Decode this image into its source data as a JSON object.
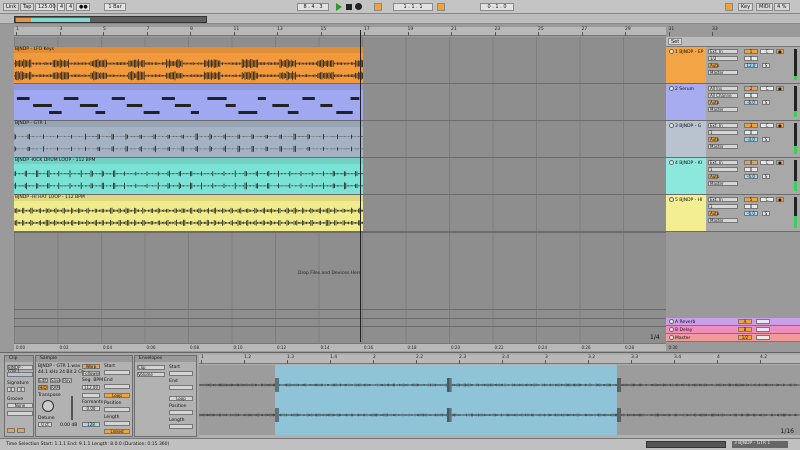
{
  "topbar": {
    "link": "Link",
    "tap": "Tap",
    "tempo": "125.00",
    "sig_num": "4",
    "sig_den": "4",
    "metro": "●●",
    "quant": "1 Bar",
    "position": "8 . 4 . 3",
    "loop_start": "1 . 1 . 1",
    "loop_len": "0 . 1 . 0",
    "key": "Key",
    "midi": "MIDI",
    "cpu": "4 %"
  },
  "ruler": [
    "1",
    "3",
    "5",
    "7",
    "9",
    "11",
    "13",
    "15",
    "17",
    "19",
    "21",
    "23",
    "25",
    "27",
    "29",
    "31",
    "33"
  ],
  "timeline": [
    "0:00",
    "0:02",
    "0:04",
    "0:06",
    "0:08",
    "0:10",
    "0:12",
    "0:14",
    "0:16",
    "0:18",
    "0:20",
    "0:22",
    "0:24",
    "0:26",
    "0:28",
    "0:30"
  ],
  "tracks": [
    {
      "clip": "BJNDP - LFO Keys",
      "name": "1 BJNDP - EP",
      "input": "Ext. In",
      "chan": "1/2",
      "vol": "0",
      "pan": "C",
      "send": "12.0",
      "monitor": "Auto",
      "out": "Master",
      "color": "#f29a3b",
      "hdr": "#f3a545"
    },
    {
      "clip": "",
      "name": "2 Serum",
      "input": "All Ins",
      "chan": "All Channe",
      "vol": "0",
      "pan": "C",
      "send": "-6.0",
      "monitor": "Auto",
      "out": "Master",
      "color": "#9fa8f0",
      "hdr": "#a6acef"
    },
    {
      "clip": "BJNDP - GTR 1",
      "name": "3 BJNDP - G",
      "input": "Ext. In",
      "chan": "1",
      "vol": "0",
      "pan": "C",
      "send": "-4.0",
      "monitor": "Auto",
      "out": "Master",
      "color": "#a5b2c4",
      "hdr": "#b9c3cf"
    },
    {
      "clip": "BJNDP -KICK DRUM LOOP - 112 BPM",
      "name": "4 BJNDP - KI",
      "input": "Ext. In",
      "chan": "1",
      "vol": "0",
      "pan": "C",
      "send": "-6.0",
      "monitor": "Auto",
      "out": "Master",
      "color": "#7be3d6",
      "hdr": "#8ce8dc"
    },
    {
      "clip": "BJNDP -HI HAT LOOP - 112 BPM",
      "name": "5 BJNDP - HI",
      "input": "Ext. In",
      "chan": "1",
      "vol": "0",
      "pan": "C",
      "send": "-6.0",
      "monitor": "Auto",
      "out": "Master",
      "color": "#f1ec8b",
      "hdr": "#f3ee92"
    }
  ],
  "returns": [
    {
      "name": "A Reverb",
      "num": "A",
      "color": "#c9a0e8"
    },
    {
      "name": "B Delay",
      "num": "B",
      "color": "#f08fbf"
    },
    {
      "name": "Master",
      "num": "1/2",
      "color": "#f39a9a"
    }
  ],
  "set_label": "Set",
  "drop_text": "Drop Files and Devices Here",
  "zoom_label": "1/4",
  "detail": {
    "clip_panel": "Clip",
    "clip_name": "BJNDP - GTR 1",
    "signature": "Signature",
    "sig_a": "4",
    "sig_b": "4",
    "groove": "Groove",
    "groove_none": "None",
    "sample_panel": "Sample",
    "sample_name": "BJNDP - GTR 1.wav",
    "sample_info": "44.1 kHz 24 Bit 2 Ch",
    "warp": "Warp",
    "warp_mode": "Follower",
    "edit": "Edit",
    "save": "Save",
    "rev": "Rev",
    "seg_bpm": "Seg. BPM",
    "hq": "HiQ",
    "ram": "RAM",
    "bpm_val": "112.00",
    "transpose": "Transpose",
    "detune": "Detune",
    "detune_val": "0 ct",
    "time_val": "0.00 dB",
    "formants": "Formants",
    "formant_val": "0.00",
    "env_mode": "128",
    "envelopes": "Envelopes",
    "env_clip": "Clip",
    "env_volume": "Volume",
    "start": "Start",
    "end": "End",
    "loop": "Loop",
    "position": "Position",
    "length": "Length",
    "linked": "Linked",
    "start2": "Start",
    "end2": "End",
    "loop2": "Loop",
    "position2": "Position",
    "length2": "Length",
    "sv_ruler": [
      "1",
      "1.2",
      "1.3",
      "1.4",
      "2",
      "2.2",
      "2.3",
      "2.4",
      "3",
      "3.2",
      "3.3",
      "3.4",
      "4",
      "4.2"
    ],
    "sv_zoom": "1/16"
  },
  "status": {
    "text": "Time Selection   Start: 1.1.1   End: 9.1.1   Length: 8.0.0   (Duration: 0:15.360)",
    "track": "3 BJNDP - GTR 1"
  }
}
